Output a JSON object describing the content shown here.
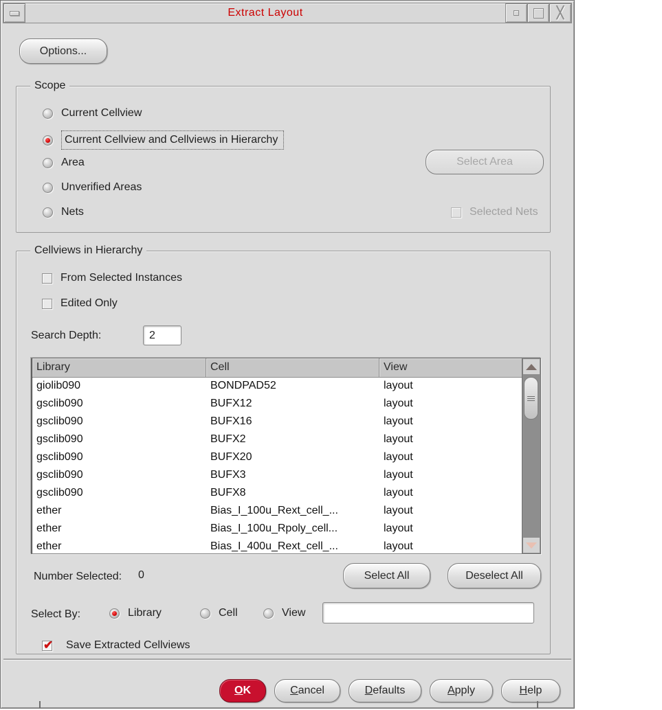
{
  "window": {
    "title": "Extract Layout"
  },
  "options_button": {
    "label": "Options..."
  },
  "scope": {
    "legend": "Scope",
    "radios": [
      {
        "label": "Current Cellview",
        "selected": false
      },
      {
        "label": "Current Cellview and Cellviews in Hierarchy",
        "selected": true
      },
      {
        "label": "Area",
        "selected": false
      },
      {
        "label": "Unverified Areas",
        "selected": false
      },
      {
        "label": "Nets",
        "selected": false
      }
    ],
    "select_area_button": "Select Area",
    "selected_nets_label": "Selected Nets"
  },
  "hierarchy": {
    "legend": "Cellviews in Hierarchy",
    "checkboxes": [
      {
        "label": "From Selected Instances",
        "checked": false
      },
      {
        "label": "Edited Only",
        "checked": false
      }
    ],
    "search_depth_label": "Search Depth:",
    "search_depth_value": "2",
    "table": {
      "columns": [
        "Library",
        "Cell",
        "View"
      ],
      "rows": [
        [
          "giolib090",
          "BONDPAD52",
          "layout"
        ],
        [
          "gsclib090",
          "BUFX12",
          "layout"
        ],
        [
          "gsclib090",
          "BUFX16",
          "layout"
        ],
        [
          "gsclib090",
          "BUFX2",
          "layout"
        ],
        [
          "gsclib090",
          "BUFX20",
          "layout"
        ],
        [
          "gsclib090",
          "BUFX3",
          "layout"
        ],
        [
          "gsclib090",
          "BUFX8",
          "layout"
        ],
        [
          "ether",
          "Bias_I_100u_Rext_cell_...",
          "layout"
        ],
        [
          "ether",
          "Bias_I_100u_Rpoly_cell...",
          "layout"
        ],
        [
          "ether",
          "Bias_I_400u_Rext_cell_...",
          "layout"
        ]
      ]
    },
    "number_selected_label": "Number Selected:",
    "number_selected_value": "0",
    "select_all_button": "Select All",
    "deselect_all_button": "Deselect All",
    "select_by": {
      "label": "Select By:",
      "options": [
        {
          "label": "Library",
          "selected": true
        },
        {
          "label": "Cell",
          "selected": false
        },
        {
          "label": "View",
          "selected": false
        }
      ],
      "filter_value": ""
    },
    "save_checkbox": {
      "label": "Save Extracted Cellviews",
      "checked": true
    }
  },
  "footer": {
    "buttons": [
      {
        "m": "O",
        "rest": "K",
        "primary": true
      },
      {
        "m": "C",
        "rest": "ancel",
        "primary": false
      },
      {
        "m": "D",
        "rest": "efaults",
        "primary": false
      },
      {
        "m": "A",
        "rest": "pply",
        "primary": false
      },
      {
        "m": "H",
        "rest": "elp",
        "primary": false
      }
    ]
  },
  "colors": {
    "title_text": "#cc0000",
    "ok_button": "#c8102e",
    "window_bg": "#dcdcdc",
    "table_header_bg": "#c6c6c6",
    "radio_selected": "#cc0000",
    "check_mark": "#cc1111"
  }
}
